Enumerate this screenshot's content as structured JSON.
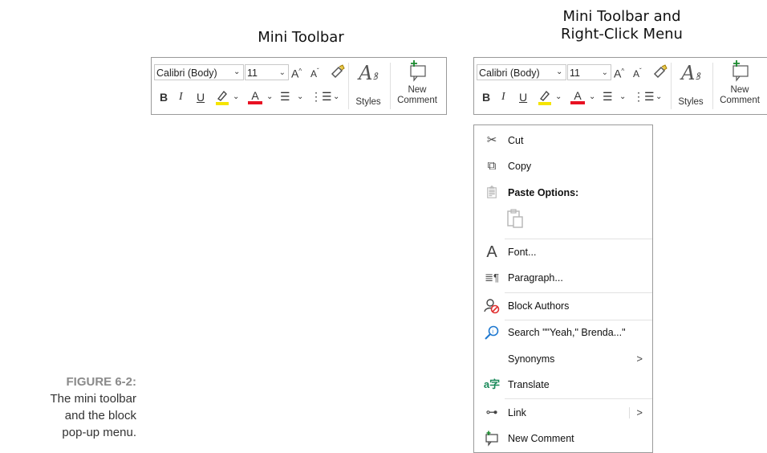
{
  "headings": {
    "left": "Mini Toolbar",
    "right_line1": "Mini Toolbar and",
    "right_line2": "Right-Click Menu"
  },
  "toolbar": {
    "font_name": "Calibri (Body)",
    "font_size": "11",
    "bold": "B",
    "italic": "I",
    "underline": "U",
    "font_color_letter": "A",
    "styles_label": "Styles",
    "new_comment_line1": "New",
    "new_comment_line2": "Comment",
    "highlight_color": "#f5e400",
    "font_color": "#e81123"
  },
  "menu": {
    "items": [
      {
        "label": "Cut",
        "icon": "scissors-icon"
      },
      {
        "label": "Copy",
        "icon": "copy-icon"
      },
      {
        "label": "Paste Options:",
        "icon": "clipboard-icon"
      },
      {
        "label": "Font...",
        "icon": "font-icon"
      },
      {
        "label": "Paragraph...",
        "icon": "paragraph-icon"
      },
      {
        "label": "Block Authors",
        "icon": "block-authors-icon"
      },
      {
        "label": "Search \"\"Yeah,\" Brenda...\"",
        "icon": "search-icon"
      },
      {
        "label": "Synonyms",
        "icon": "none"
      },
      {
        "label": "Translate",
        "icon": "translate-icon"
      },
      {
        "label": "Link",
        "icon": "link-icon"
      },
      {
        "label": "New Comment",
        "icon": "new-comment-icon"
      }
    ],
    "submenu_arrow": ">"
  },
  "caption": {
    "figure": "FIGURE 6-2:",
    "line1": "The mini toolbar",
    "line2": "and the block",
    "line3": "pop-up menu."
  }
}
